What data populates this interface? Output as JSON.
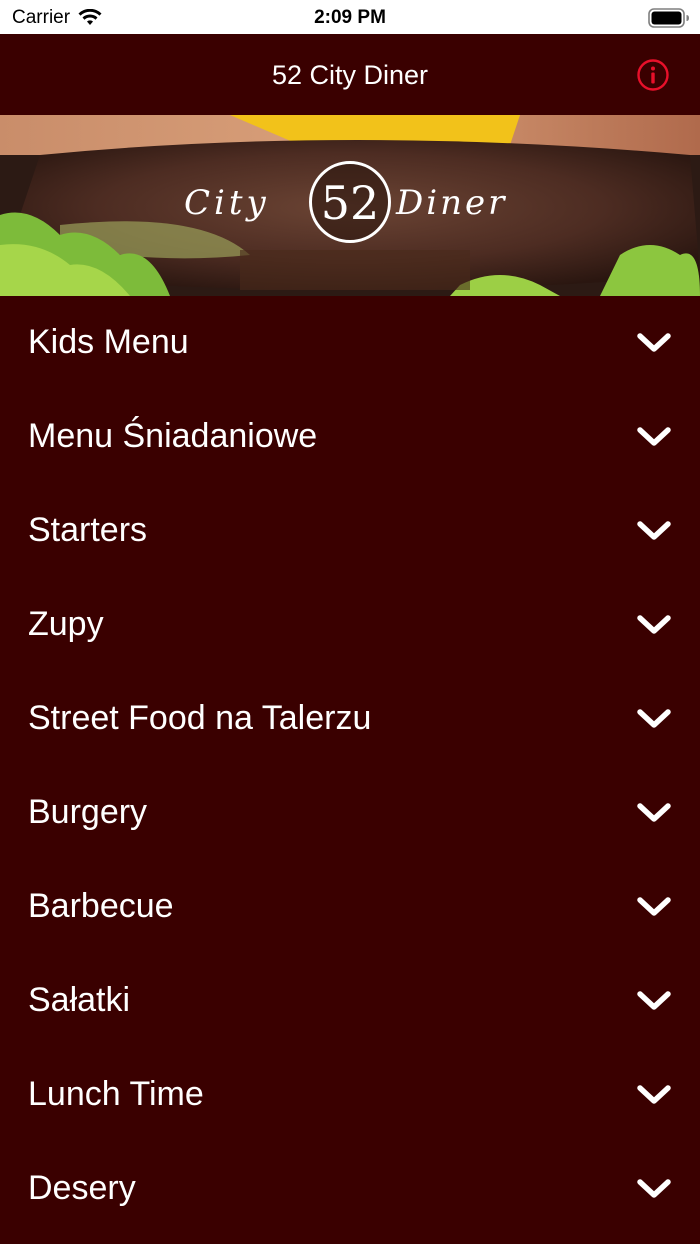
{
  "status_bar": {
    "carrier": "Carrier",
    "time": "2:09 PM"
  },
  "header": {
    "title": "52 City Diner",
    "info_icon": "info-circle-icon",
    "info_color": "#e8102a"
  },
  "hero": {
    "logo_left": "City",
    "logo_number": "52",
    "logo_right": "Diner"
  },
  "menu": {
    "items": [
      {
        "label": "Kids Menu"
      },
      {
        "label": "Menu Śniadaniowe"
      },
      {
        "label": "Starters"
      },
      {
        "label": "Zupy"
      },
      {
        "label": "Street Food na Talerzu"
      },
      {
        "label": "Burgery"
      },
      {
        "label": "Barbecue"
      },
      {
        "label": "Sałatki"
      },
      {
        "label": "Lunch Time"
      },
      {
        "label": "Desery"
      }
    ],
    "chevron_icon": "chevron-down-icon"
  },
  "colors": {
    "background": "#3a0000",
    "text": "#ffffff",
    "accent": "#e8102a"
  }
}
